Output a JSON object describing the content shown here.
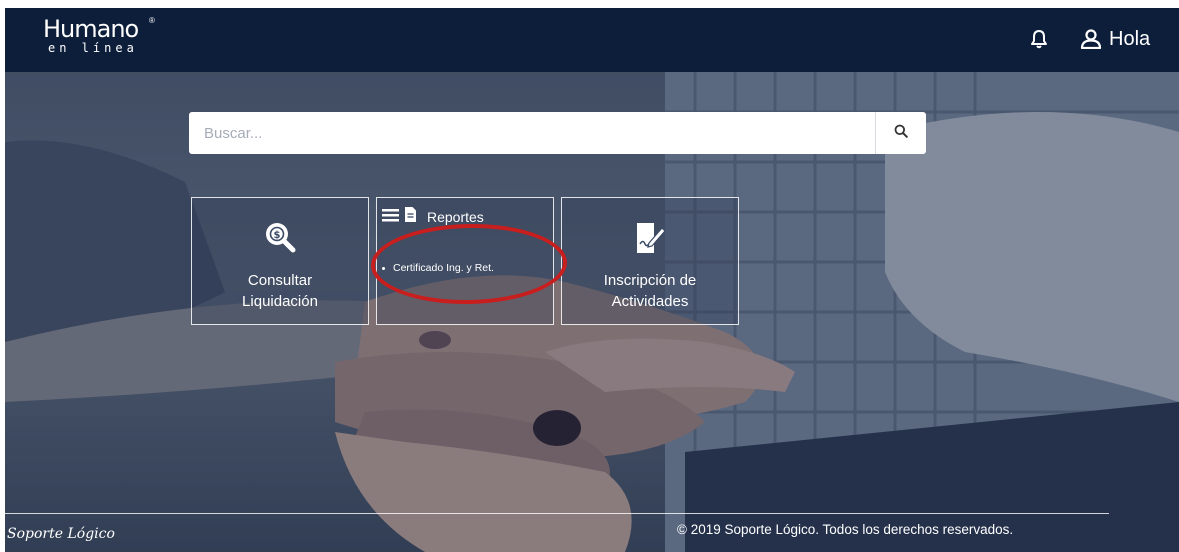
{
  "header": {
    "logo_main": "Humano",
    "logo_registered": "®",
    "logo_sub": "en línea",
    "greeting": "Hola",
    "bar_color": "#0d1e3b"
  },
  "search": {
    "placeholder": "Buscar...",
    "value": "",
    "button_icon": "search-icon"
  },
  "tiles": {
    "consultar": {
      "line1": "Consultar",
      "line2": "Liquidación",
      "icon": "dollar-search-icon"
    },
    "reportes": {
      "title": "Reportes",
      "icons": [
        "list-icon",
        "document-icon"
      ],
      "items": [
        "Certificado Ing. y Ret."
      ]
    },
    "inscripcion": {
      "line1": "Inscripción de",
      "line2": "Actividades",
      "icon": "signed-document-icon"
    }
  },
  "annotation": {
    "color": "#c81e1e",
    "shape": "ellipse"
  },
  "footer": {
    "signature": "Soporte Lógico",
    "copyright": "© 2019 Soporte Lógico. Todos los derechos reservados."
  }
}
